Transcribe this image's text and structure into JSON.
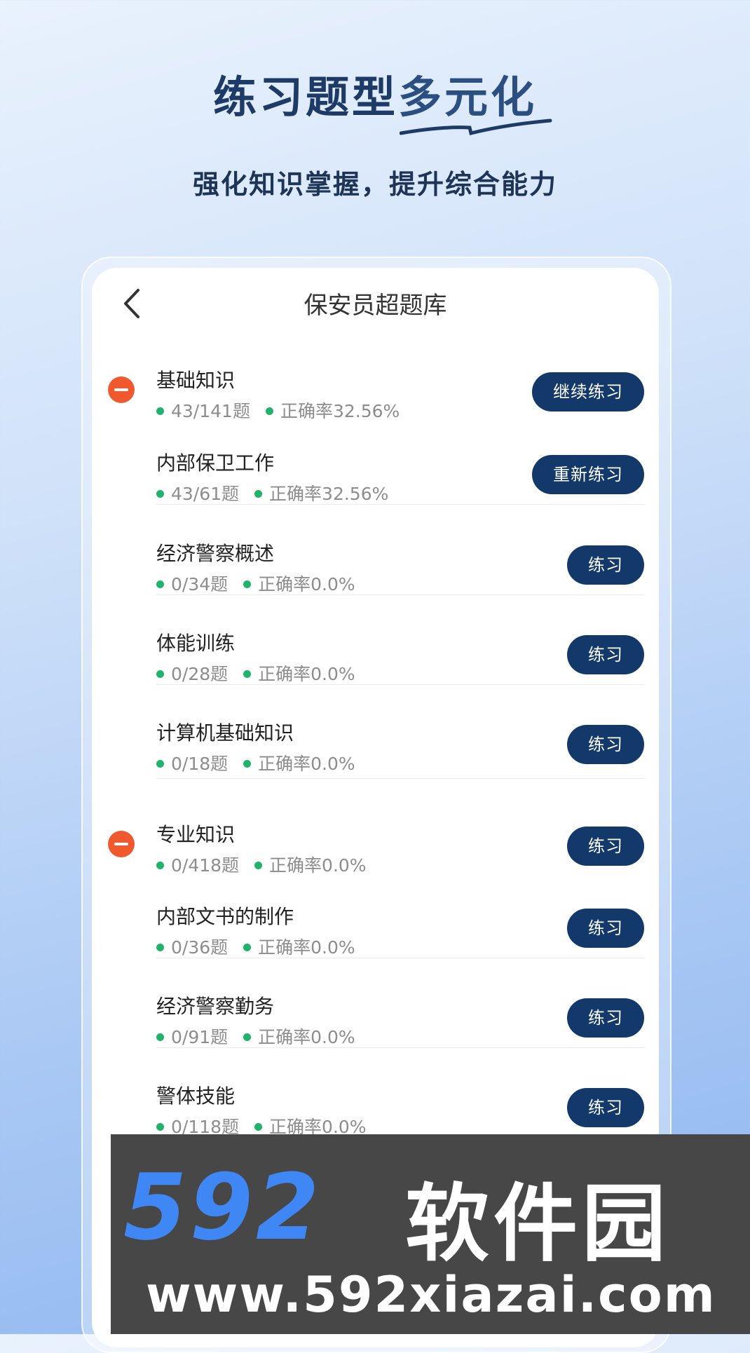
{
  "headline": {
    "part1": "练习题型",
    "part2": "多元化",
    "subtitle": "强化知识掌握，提升综合能力"
  },
  "header": {
    "title": "保安员超题库",
    "back_icon": "chevron-left-icon"
  },
  "sections": [
    {
      "title": "基础知识",
      "count": "43/141题",
      "accuracy": "正确率32.56%",
      "button": "继续练习",
      "items": [
        {
          "title": "内部保卫工作",
          "count": "43/61题",
          "accuracy": "正确率32.56%",
          "button": "重新练习"
        },
        {
          "title": "经济警察概述",
          "count": "0/34题",
          "accuracy": "正确率0.0%",
          "button": "练习"
        },
        {
          "title": "体能训练",
          "count": "0/28题",
          "accuracy": "正确率0.0%",
          "button": "练习"
        },
        {
          "title": "计算机基础知识",
          "count": "0/18题",
          "accuracy": "正确率0.0%",
          "button": "练习"
        }
      ]
    },
    {
      "title": "专业知识",
      "count": "0/418题",
      "accuracy": "正确率0.0%",
      "button": "练习",
      "items": [
        {
          "title": "内部文书的制作",
          "count": "0/36题",
          "accuracy": "正确率0.0%",
          "button": "练习"
        },
        {
          "title": "经济警察勤务",
          "count": "0/91题",
          "accuracy": "正确率0.0%",
          "button": "练习"
        },
        {
          "title": "警体技能",
          "count": "0/118题",
          "accuracy": "正确率0.0%",
          "button": "练习"
        }
      ]
    }
  ],
  "watermark": {
    "logo": "592",
    "name": "软件园",
    "url": "www.592xiazai.com"
  },
  "colors": {
    "button": "#13386a",
    "dot": "#21b36c",
    "collapse": "#f0582e"
  }
}
